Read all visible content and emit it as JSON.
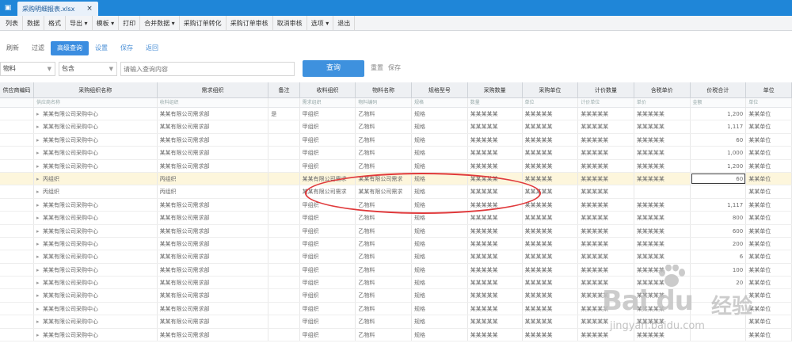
{
  "titlebar": {
    "sys_tab": "▣",
    "doc_tab": "采购明细报表.xlsx",
    "close_glyph": "×"
  },
  "menubar": {
    "items": [
      "列表",
      "数据",
      "格式",
      "导出 ▾",
      "模板 ▾",
      "打印",
      "合并数据 ▾",
      "采购订单转化",
      "采购订单审核",
      "取消审核",
      "选项 ▾",
      "退出"
    ]
  },
  "toolbar": {
    "items": [
      "刷新",
      "过滤",
      "高级查询",
      "设置",
      "保存",
      "返回"
    ],
    "active_index": 2
  },
  "filter": {
    "field": "物料",
    "operator": "包含",
    "value": "",
    "value_placeholder": "请输入查询内容",
    "query_button": "查询",
    "reset_link": "重置",
    "save_link": "保存"
  },
  "grid": {
    "columns": [
      "供应商编码",
      "采购组织名称",
      "需求组织",
      "备注",
      "收料组织",
      "物料名称",
      "规格型号",
      "采购数量",
      "采购单位",
      "计价数量",
      "含税单价",
      "价税合计",
      "单位"
    ],
    "subheader": [
      "",
      "供应商名称",
      "收料组织",
      "",
      "需求组织",
      "物料编码",
      "规格",
      "数量",
      "单位",
      "计价单位",
      "单价",
      "金额",
      "单位"
    ],
    "rows": [
      [
        "",
        "某某有限公司采购中心",
        "某某有限公司需求部",
        "是",
        "甲组织",
        "乙物料",
        "规格",
        "某某某某某",
        "某某某某某",
        "某某某某某",
        "某某某某某",
        "1,200",
        "某某单位"
      ],
      [
        "",
        "某某有限公司采购中心",
        "某某有限公司需求部",
        "",
        "甲组织",
        "乙物料",
        "规格",
        "某某某某某",
        "某某某某某",
        "某某某某某",
        "某某某某某",
        "1,117",
        "某某单位"
      ],
      [
        "",
        "某某有限公司采购中心",
        "某某有限公司需求部",
        "",
        "甲组织",
        "乙物料",
        "规格",
        "某某某某某",
        "某某某某某",
        "某某某某某",
        "某某某某某",
        "60",
        "某某单位"
      ],
      [
        "",
        "某某有限公司采购中心",
        "某某有限公司需求部",
        "",
        "甲组织",
        "乙物料",
        "规格",
        "某某某某某",
        "某某某某某",
        "某某某某某",
        "某某某某某",
        "1,000",
        "某某单位"
      ],
      [
        "",
        "某某有限公司采购中心",
        "某某有限公司需求部",
        "",
        "甲组织",
        "乙物料",
        "规格",
        "某某某某某",
        "某某某某某",
        "某某某某某",
        "某某某某某",
        "1,200",
        "某某单位"
      ],
      [
        "",
        "丙组织",
        "丙组织",
        "",
        "某某有限公司需求",
        "某某有限公司需求",
        "规格",
        "某某某某某",
        "某某某某某",
        "某某某某某",
        "某某某某某",
        "60",
        "某某单位"
      ],
      [
        "",
        "丙组织",
        "丙组织",
        "",
        "某某有限公司需求",
        "某某有限公司需求",
        "规格",
        "某某某某某",
        "某某某某某",
        "某某某某某",
        "",
        "",
        "某某单位"
      ],
      [
        "",
        "某某有限公司采购中心",
        "某某有限公司需求部",
        "",
        "甲组织",
        "乙物料",
        "规格",
        "某某某某某",
        "某某某某某",
        "某某某某某",
        "某某某某某",
        "1,117",
        "某某单位"
      ],
      [
        "",
        "某某有限公司采购中心",
        "某某有限公司需求部",
        "",
        "甲组织",
        "乙物料",
        "规格",
        "某某某某某",
        "某某某某某",
        "某某某某某",
        "某某某某某",
        "800",
        "某某单位"
      ],
      [
        "",
        "某某有限公司采购中心",
        "某某有限公司需求部",
        "",
        "甲组织",
        "乙物料",
        "规格",
        "某某某某某",
        "某某某某某",
        "某某某某某",
        "某某某某某",
        "600",
        "某某单位"
      ],
      [
        "",
        "某某有限公司采购中心",
        "某某有限公司需求部",
        "",
        "甲组织",
        "乙物料",
        "规格",
        "某某某某某",
        "某某某某某",
        "某某某某某",
        "某某某某某",
        "200",
        "某某单位"
      ],
      [
        "",
        "某某有限公司采购中心",
        "某某有限公司需求部",
        "",
        "甲组织",
        "乙物料",
        "规格",
        "某某某某某",
        "某某某某某",
        "某某某某某",
        "某某某某某",
        "6",
        "某某单位"
      ],
      [
        "",
        "某某有限公司采购中心",
        "某某有限公司需求部",
        "",
        "甲组织",
        "乙物料",
        "规格",
        "某某某某某",
        "某某某某某",
        "某某某某某",
        "某某某某某",
        "100",
        "某某单位"
      ],
      [
        "",
        "某某有限公司采购中心",
        "某某有限公司需求部",
        "",
        "甲组织",
        "乙物料",
        "规格",
        "某某某某某",
        "某某某某某",
        "某某某某某",
        "某某某某某",
        "20",
        "某某单位"
      ],
      [
        "",
        "某某有限公司采购中心",
        "某某有限公司需求部",
        "",
        "甲组织",
        "乙物料",
        "规格",
        "某某某某某",
        "某某某某某",
        "某某某某某",
        "某某某某某",
        "",
        "某某单位"
      ],
      [
        "",
        "某某有限公司采购中心",
        "某某有限公司需求部",
        "",
        "甲组织",
        "乙物料",
        "规格",
        "某某某某某",
        "某某某某某",
        "某某某某某",
        "某某某某某",
        "",
        "某某单位"
      ],
      [
        "",
        "某某有限公司采购中心",
        "某某有限公司需求部",
        "",
        "甲组织",
        "乙物料",
        "规格",
        "某某某某某",
        "某某某某某",
        "某某某某某",
        "某某某某某",
        "",
        "某某单位"
      ],
      [
        "",
        "某某有限公司采购中心",
        "某某有限公司需求部",
        "",
        "甲组织",
        "乙物料",
        "规格",
        "某某某某某",
        "某某某某某",
        "某某某某某",
        "某某某某某",
        "",
        "某某单位"
      ]
    ],
    "highlight_row": 5,
    "selected_cell": [
      5,
      11
    ]
  },
  "watermark": {
    "brand": "Bai du",
    "brand_cn": "经验",
    "url": "jingyan.baidu.com"
  },
  "colors": {
    "title_bar": "#1f86d8",
    "primary_button": "#3e91de",
    "row_highlight": "#fdf6dc",
    "annotation": "#e0393b"
  },
  "icons": {
    "expander": "triangle-right-icon",
    "watermark": "paw-logo-icon"
  }
}
